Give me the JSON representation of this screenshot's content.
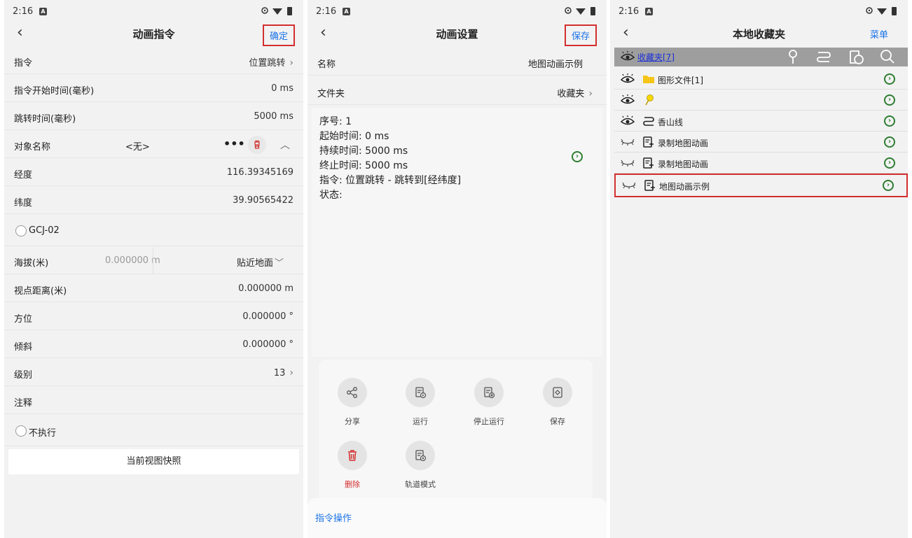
{
  "status": {
    "time": "2:16",
    "notif_letter": "A"
  },
  "panel1": {
    "title": "动画指令",
    "confirm": "确定",
    "rows": {
      "command": {
        "label": "指令",
        "value": "位置跳转"
      },
      "start_time": {
        "label": "指令开始时间(毫秒)",
        "value": "0 ms"
      },
      "jump_time": {
        "label": "跳转时间(毫秒)",
        "value": "5000 ms"
      },
      "object_name": {
        "label": "对象名称",
        "value": "<无>"
      },
      "longitude": {
        "label": "经度",
        "value": "116.39345169"
      },
      "latitude": {
        "label": "纬度",
        "value": "39.90565422"
      },
      "gcj": {
        "label": "GCJ-02"
      },
      "altitude": {
        "label": "海拔(米)",
        "value": "0.000000 m",
        "mode": "贴近地面"
      },
      "view_distance": {
        "label": "视点距离(米)",
        "value": "0.000000 m"
      },
      "azimuth": {
        "label": "方位",
        "value": "0.000000 °"
      },
      "tilt": {
        "label": "倾斜",
        "value": "0.000000 °"
      },
      "level": {
        "label": "级别",
        "value": "13"
      },
      "note": {
        "label": "注释"
      },
      "no_exec": {
        "label": "不执行"
      }
    },
    "snapshot_button": "当前视图快照"
  },
  "panel2": {
    "title": "动画设置",
    "save": "保存",
    "name_label": "名称",
    "name_value": "地图动画示例",
    "folder_label": "文件夹",
    "folder_value": "收藏夹",
    "info": {
      "seq": "序号: 1",
      "start": "起始时间: 0 ms",
      "duration": "持续时间: 5000 ms",
      "end": "终止时间: 5000 ms",
      "cmd": "指令: 位置跳转 - 跳转到[经纬度]",
      "state": "状态:"
    },
    "actions": {
      "share": "分享",
      "run": "运行",
      "stop": "停止运行",
      "save": "保存",
      "delete": "删除",
      "track": "轨道模式"
    },
    "footer": "指令操作",
    "colors": {
      "delete": "#d32f2f",
      "accent": "#1a73e8"
    }
  },
  "panel3": {
    "title": "本地收藏夹",
    "menu": "菜单",
    "fav_label": "收藏夹[7]",
    "items": [
      {
        "label": "图形文件[1]",
        "icon": "folder-icon"
      },
      {
        "label": "",
        "icon": "pushpin-icon"
      },
      {
        "label": "香山线",
        "icon": "route-icon"
      },
      {
        "label": "录制地图动画",
        "icon": "animation-icon"
      },
      {
        "label": "录制地图动画",
        "icon": "animation-icon"
      },
      {
        "label": "地图动画示例",
        "icon": "animation-icon"
      }
    ]
  }
}
